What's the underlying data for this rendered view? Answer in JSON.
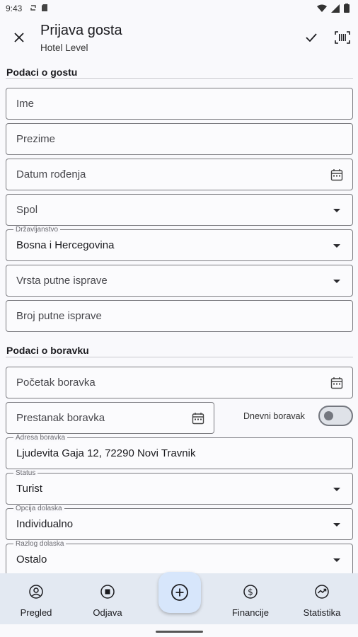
{
  "status_bar": {
    "time": "9:43"
  },
  "app_bar": {
    "title": "Prijava gosta",
    "subtitle": "Hotel Level"
  },
  "sections": {
    "guest": "Podaci o gostu",
    "stay": "Podaci o boravku"
  },
  "guest_fields": {
    "first_name": {
      "placeholder": "Ime"
    },
    "last_name": {
      "placeholder": "Prezime"
    },
    "birth_date": {
      "placeholder": "Datum rođenja"
    },
    "gender": {
      "placeholder": "Spol"
    },
    "citizenship": {
      "label": "Državljanstvo",
      "value": "Bosna i Hercegovina"
    },
    "document_type": {
      "placeholder": "Vrsta putne isprave"
    },
    "document_number": {
      "placeholder": "Broj putne isprave"
    }
  },
  "stay_fields": {
    "start": {
      "placeholder": "Početak boravka"
    },
    "end": {
      "placeholder": "Prestanak boravka"
    },
    "day_stay": {
      "label": "Dnevni boravak",
      "on": false
    },
    "address": {
      "label": "Adresa boravka",
      "value": "Ljudevita Gaja 12, 72290 Novi Travnik"
    },
    "status": {
      "label": "Status",
      "value": "Turist"
    },
    "arrival_option": {
      "label": "Opcija dolaska",
      "value": "Individualno"
    },
    "arrival_reason": {
      "label": "Razlog dolaska",
      "value": "Ostalo"
    }
  },
  "bottom_nav": {
    "items": [
      {
        "label": "Pregled",
        "icon": "account-circle-icon"
      },
      {
        "label": "Odjava",
        "icon": "stop-circle-icon"
      },
      {
        "label": "Financije",
        "icon": "dollar-circle-icon"
      },
      {
        "label": "Statistika",
        "icon": "trend-circle-icon"
      }
    ],
    "fab_icon": "add-circle-icon"
  },
  "colors": {
    "nav_bg": "#e3e9f2",
    "fab_bg": "#d7e6fb",
    "field_border": "#7b7b80"
  }
}
